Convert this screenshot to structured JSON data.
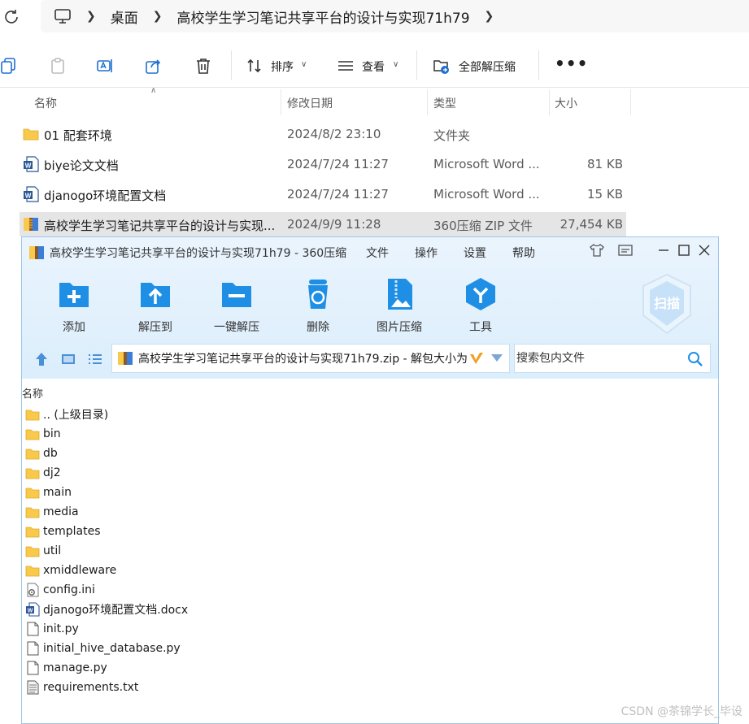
{
  "breadcrumb": [
    "桌面",
    "高校学生学习笔记共享平台的设计与实现71h79"
  ],
  "toolbar": {
    "sort": "排序",
    "view": "查看",
    "extract_all": "全部解压缩"
  },
  "columns": {
    "name": "名称",
    "date": "修改日期",
    "type": "类型",
    "size": "大小"
  },
  "files": [
    {
      "name": "01 配套环境",
      "date": "2024/8/2 23:10",
      "type": "文件夹",
      "size": "",
      "icon": "folder-icon"
    },
    {
      "name": "biye论文文档",
      "date": "2024/7/24 11:27",
      "type": "Microsoft Word ...",
      "size": "81 KB",
      "icon": "word-doc-icon"
    },
    {
      "name": "djanogo环境配置文档",
      "date": "2024/7/24 11:27",
      "type": "Microsoft Word ...",
      "size": "15 KB",
      "icon": "word-doc-icon"
    },
    {
      "name": "高校学生学习笔记共享平台的设计与实现...",
      "date": "2024/9/9 11:28",
      "type": "360压缩 ZIP 文件",
      "size": "27,454 KB",
      "icon": "zip-archive-icon"
    }
  ],
  "zip": {
    "title": "高校学生学习笔记共享平台的设计与实现71h79 - 360压缩",
    "menu": [
      "文件",
      "操作",
      "设置",
      "帮助"
    ],
    "tools": [
      "添加",
      "解压到",
      "一键解压",
      "删除",
      "图片压缩",
      "工具"
    ],
    "scan": "扫描",
    "path": "高校学生学习笔记共享平台的设计与实现71h79.zip - 解包大小为",
    "search_placeholder": "搜索包内文件",
    "column_name": "名称",
    "entries": [
      {
        "name": ".. (上级目录)",
        "icon": "folder-icon"
      },
      {
        "name": "bin",
        "icon": "folder-icon"
      },
      {
        "name": "db",
        "icon": "folder-icon"
      },
      {
        "name": "dj2",
        "icon": "folder-icon"
      },
      {
        "name": "main",
        "icon": "folder-icon"
      },
      {
        "name": "media",
        "icon": "folder-icon"
      },
      {
        "name": "templates",
        "icon": "folder-icon"
      },
      {
        "name": "util",
        "icon": "folder-icon"
      },
      {
        "name": "xmiddleware",
        "icon": "folder-icon"
      },
      {
        "name": "config.ini",
        "icon": "config-file-icon"
      },
      {
        "name": "djanogo环境配置文档.docx",
        "icon": "word-doc-icon"
      },
      {
        "name": "init.py",
        "icon": "file-icon"
      },
      {
        "name": "initial_hive_database.py",
        "icon": "file-icon"
      },
      {
        "name": "manage.py",
        "icon": "file-icon"
      },
      {
        "name": "requirements.txt",
        "icon": "text-file-icon"
      }
    ]
  },
  "watermark": "CSDN @茶锦学长_毕设",
  "colors": {
    "folder": "#f8c94a",
    "word": "#2b5797",
    "accent360": "#1f8fe6",
    "selected_row": "#e5e5e5"
  }
}
